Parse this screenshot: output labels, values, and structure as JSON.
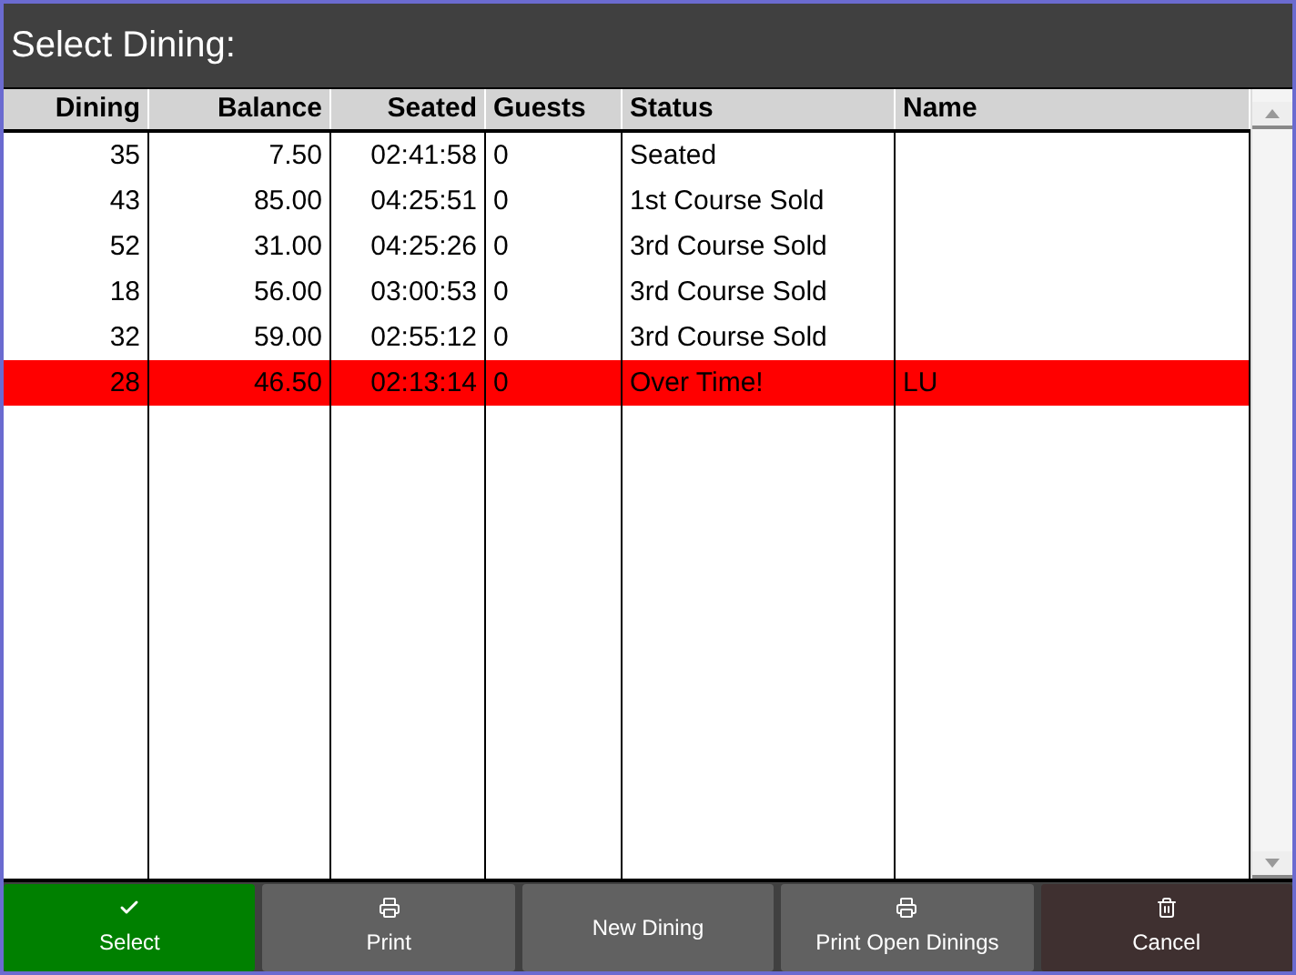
{
  "window": {
    "title": "Select Dining:"
  },
  "table": {
    "columns": [
      "Dining",
      "Balance",
      "Seated",
      "Guests",
      "Status",
      "Name"
    ],
    "rows": [
      {
        "cells": [
          "35",
          "7.50",
          "02:41:58",
          "0",
          "Seated",
          ""
        ],
        "highlighted": false
      },
      {
        "cells": [
          "43",
          "85.00",
          "04:25:51",
          "0",
          "1st Course Sold",
          ""
        ],
        "highlighted": false
      },
      {
        "cells": [
          "52",
          "31.00",
          "04:25:26",
          "0",
          "3rd Course Sold",
          ""
        ],
        "highlighted": false
      },
      {
        "cells": [
          "18",
          "56.00",
          "03:00:53",
          "0",
          "3rd Course Sold",
          ""
        ],
        "highlighted": false
      },
      {
        "cells": [
          "32",
          "59.00",
          "02:55:12",
          "0",
          "3rd Course Sold",
          ""
        ],
        "highlighted": false
      },
      {
        "cells": [
          "28",
          "46.50",
          "02:13:14",
          "0",
          "Over Time!",
          "LU"
        ],
        "highlighted": true
      }
    ]
  },
  "buttons": [
    {
      "label": "Select",
      "kind": "select"
    },
    {
      "label": "Print",
      "kind": "print"
    },
    {
      "label": "New Dining",
      "kind": "plain"
    },
    {
      "label": "Print Open Dinings",
      "kind": "print"
    },
    {
      "label": "Cancel",
      "kind": "cancel"
    }
  ]
}
